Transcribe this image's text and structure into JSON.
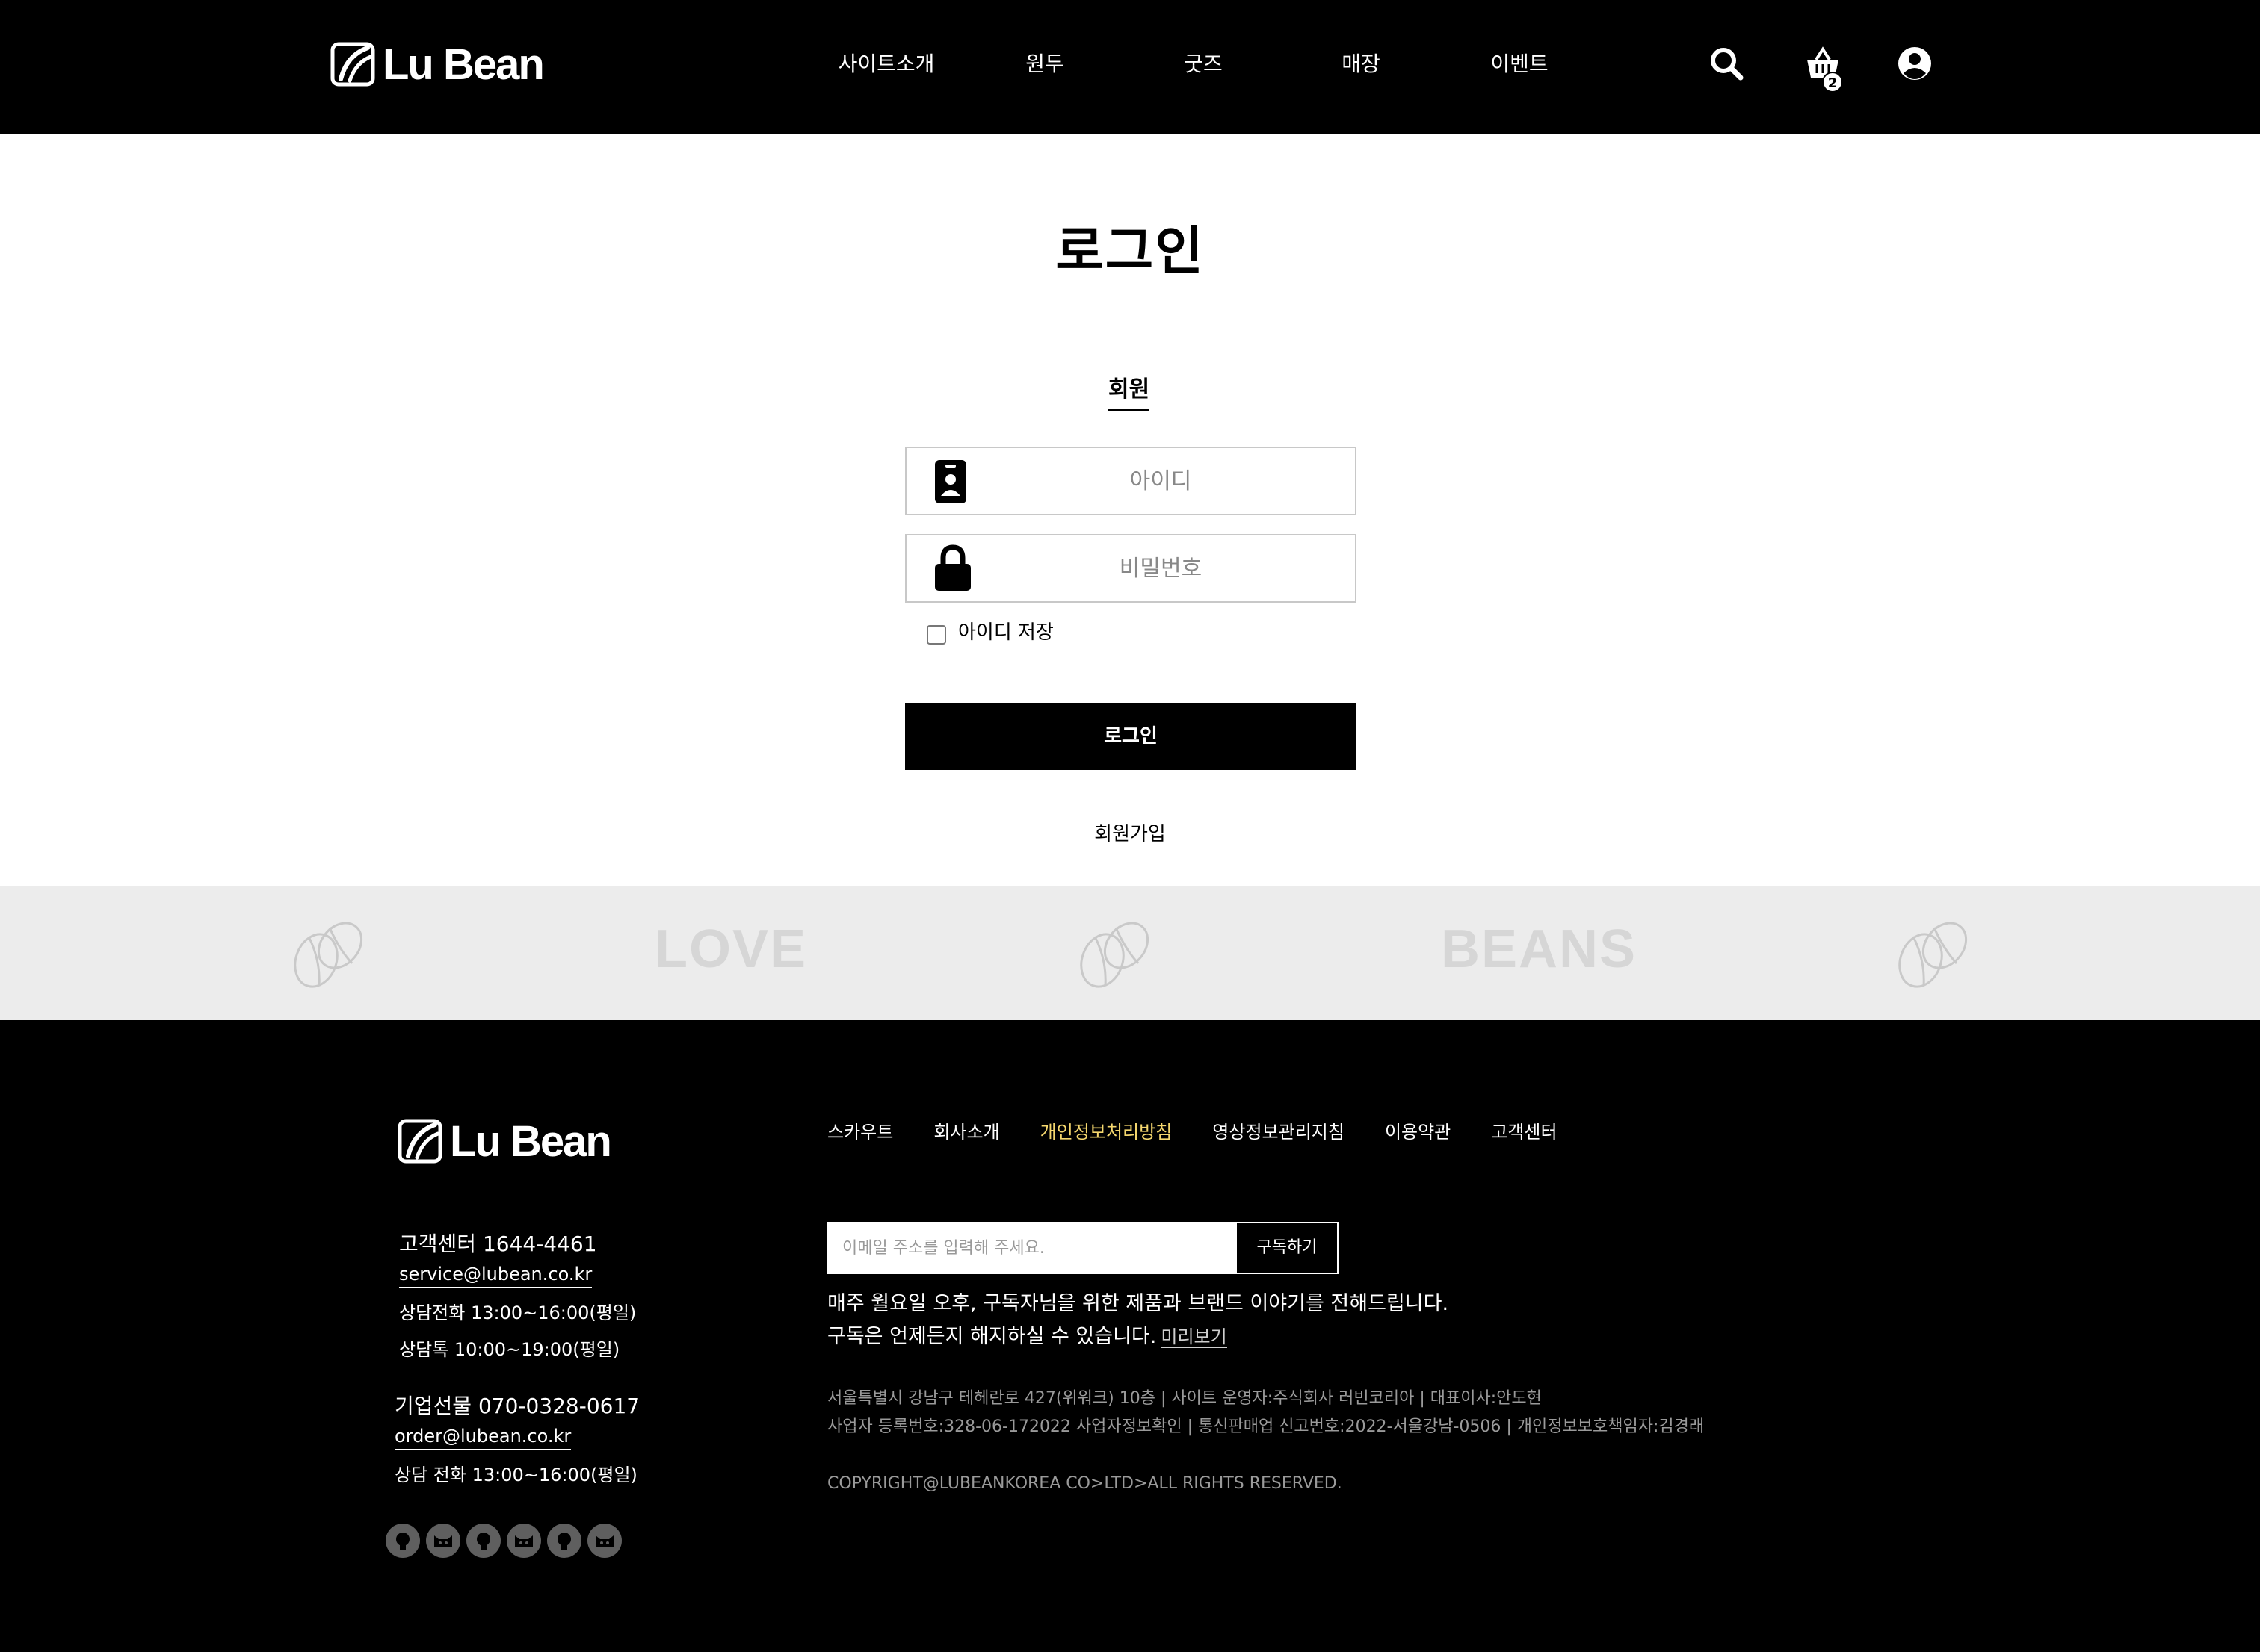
{
  "brand": {
    "name": "Lu Bean"
  },
  "header": {
    "nav": [
      "사이트소개",
      "원두",
      "굿즈",
      "매장",
      "이벤트"
    ],
    "cart_count": "2"
  },
  "login": {
    "title": "로그인",
    "tab_member": "회원",
    "id_placeholder": "아이디",
    "pw_placeholder": "비밀번호",
    "remember_label": "아이디 저장",
    "submit_label": "로그인",
    "signup_label": "회원가입"
  },
  "band": {
    "words": [
      "LOVE",
      "BEANS"
    ]
  },
  "footer": {
    "cs": {
      "title": "고객센터 1644-4461",
      "email": "service@lubean.co.kr",
      "hours_phone": "상담전화 13:00~16:00(평일)",
      "hours_talk": "상담톡 10:00~19:00(평일)"
    },
    "corp": {
      "title": "기업선물 070-0328-0617",
      "email": "order@lubean.co.kr",
      "hours": "상담 전화 13:00~16:00(평일)"
    },
    "links": [
      "스카우트",
      "회사소개",
      "개인정보처리방침",
      "영상정보관리지침",
      "이용약관",
      "고객센터"
    ],
    "highlight_color": "#f5d76e",
    "subscribe": {
      "placeholder": "이메일 주소를 입력해 주세요.",
      "button": "구독하기",
      "desc_line1": "매주 월요일 오후, 구독자님을 위한 제품과 브랜드 이야기를 전해드립니다.",
      "desc_line2": "구독은 언제든지 해지하실 수 있습니다.",
      "preview": "미리보기"
    },
    "info_line1": "서울특별시 강남구 테헤란로 427(위워크) 10층 | 사이트 운영자:주식회사 러빈코리아 | 대표이사:안도현",
    "info_line2": "사업자 등록번호:328-06-172022 사업자정보확인 | 통신판매업 신고번호:2022-서울강남-0506 | 개인정보보호책임자:김경래",
    "copyright": "COPYRIGHT@LUBEANKOREA CO>LTD>ALL RIGHTS RESERVED.",
    "social_icons": [
      "github-icon",
      "cat-icon",
      "github-icon",
      "cat-icon",
      "github-icon",
      "cat-icon"
    ]
  }
}
